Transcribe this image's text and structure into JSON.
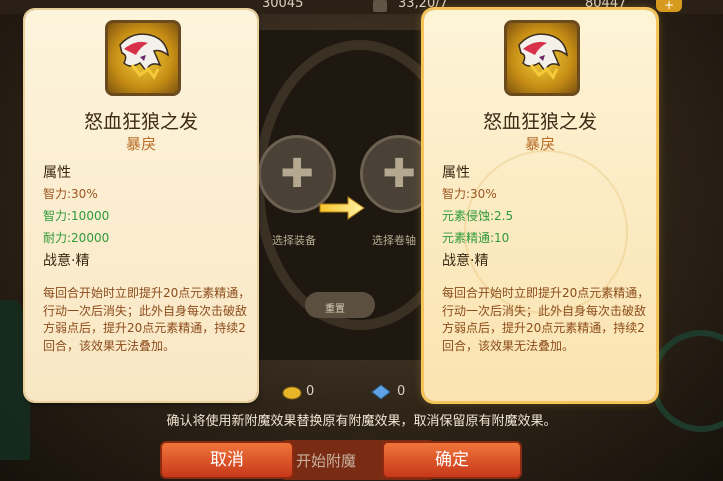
{
  "top_bar": {
    "res1": "30045",
    "res2": "33,20/7",
    "res3": "80447"
  },
  "center": {
    "slot_left_label": "选择装备",
    "slot_right_label": "选择卷轴",
    "reset_label": "重置",
    "stone1_count": "0",
    "stone2_count": "0"
  },
  "left_card": {
    "name": "怒血狂狼之发",
    "quality": "暴戾",
    "attr_title": "属性",
    "base_attr": "智力:30%",
    "enchant_attrs": [
      "智力:10000",
      "耐力:20000"
    ],
    "skill_title": "战意·精",
    "skill_desc": "每回合开始时立即提升20点元素精通，行动一次后消失；此外自身每次击破敌方弱点后，提升20点元素精通，持续2回合，该效果无法叠加。"
  },
  "right_card": {
    "name": "怒血狂狼之发",
    "quality": "暴戾",
    "attr_title": "属性",
    "base_attr": "智力:30%",
    "enchant_attrs": [
      "元素侵蚀:2.5",
      "元素精通:10"
    ],
    "skill_title": "战意·精",
    "skill_desc": "每回合开始时立即提升20点元素精通，行动一次后消失；此外自身每次击破敌方弱点后，提升20点元素精通，持续2回合，该效果无法叠加。"
  },
  "notice": "确认将使用新附魔效果替换原有附魔效果，取消保留原有附魔效果。",
  "buttons": {
    "start_enchant": "开始附魔",
    "cancel": "取消",
    "confirm": "确定"
  },
  "colors": {
    "attr_brown": "#9c5620",
    "attr_green": "#2e9a3a",
    "button_orange": "#e0592b",
    "highlight_gold": "#f4c45a"
  }
}
